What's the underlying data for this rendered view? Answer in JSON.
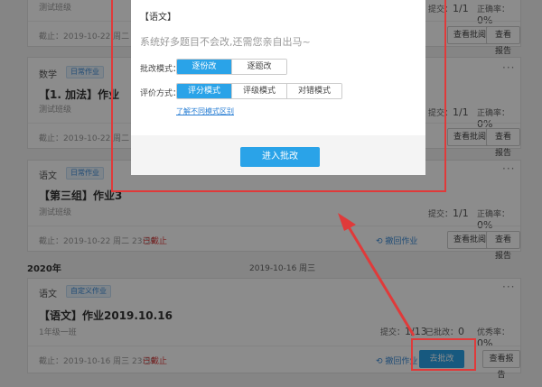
{
  "cards": [
    {
      "sub": "测试班级",
      "deadline": "截止：2019-10-22 周二 23:59",
      "stat_submit_label": "提交：",
      "stat_submit_value": "1/1",
      "stat_rate_label": "正确率：",
      "stat_rate_value": "0%",
      "btn_review": "查看批阅",
      "btn_report": "查看报告"
    },
    {
      "subject": "数学",
      "tag": "日常作业",
      "title": "【1. 加法】作业",
      "sub": "测试班级",
      "deadline": "截止：2019-10-22 周二 23:59",
      "stat_submit_label": "提交：",
      "stat_submit_value": "1/1",
      "stat_rate_label": "正确率：",
      "stat_rate_value": "0%",
      "btn_review": "查看批阅",
      "btn_report": "查看报告"
    },
    {
      "subject": "语文",
      "tag": "日常作业",
      "title": "【第三组】作业3",
      "sub": "测试班级",
      "deadline": "截止：2019-10-22 周二 23:59",
      "ended": "已截止",
      "backfile": "撤回作业",
      "stat_submit_label": "提交：",
      "stat_submit_value": "1/1",
      "stat_rate_label": "正确率：",
      "stat_rate_value": "0%",
      "btn_review": "查看批阅",
      "btn_report": "查看报告"
    },
    {
      "subject": "语文",
      "tag": "自定义作业",
      "title": "【语文】作业2019.10.16",
      "sub": "1年级一班",
      "deadline": "截止：2019-10-16 周三 23:59",
      "ended": "已截止",
      "backfile": "撤回作业",
      "stat_submit_label": "提交：",
      "stat_submit_value": "1/13",
      "stat_reviewed_label": "已批改：",
      "stat_reviewed_value": "0",
      "stat_excellent_label": "优秀率：",
      "stat_excellent_value": "0%",
      "btn_go": "去批改",
      "btn_report": "查看报告"
    }
  ],
  "group": {
    "year": "2020年",
    "date": "2019-10-16 周三"
  },
  "modal": {
    "header": "【语文】",
    "message": "系统好多题目不会改,还需您亲自出马~",
    "mode_label": "批改模式：",
    "mode_options": [
      "逐份改",
      "逐题改"
    ],
    "eval_label": "评价方式：",
    "eval_options": [
      "评分模式",
      "评级模式",
      "对错模式"
    ],
    "link": "了解不同模式区别",
    "start": "进入批改"
  },
  "colors": {
    "accent": "#2aa3e8",
    "highlight": "#e03a3a",
    "ended": "#e04040"
  }
}
